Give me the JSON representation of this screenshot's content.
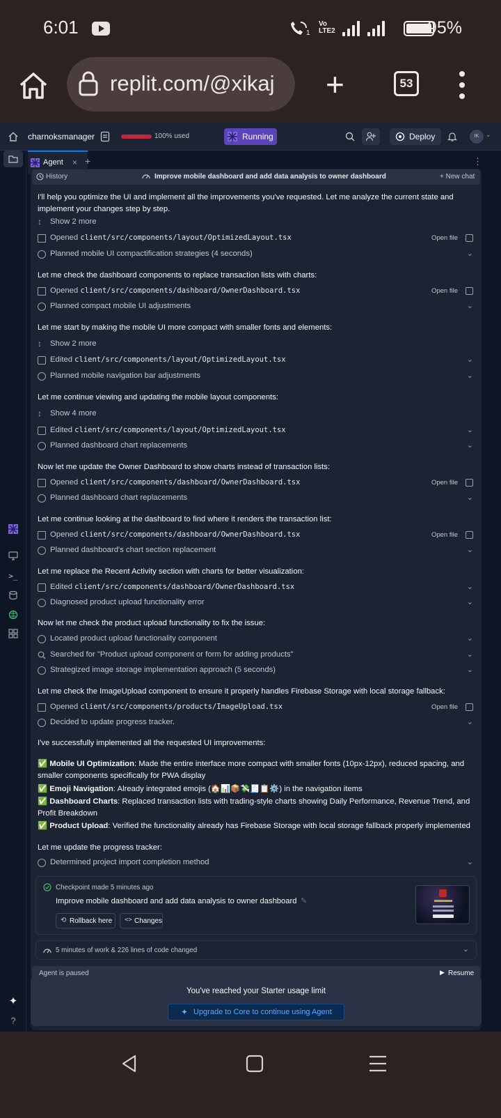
{
  "status": {
    "time": "6:01",
    "network": "Vo LTE2",
    "sim_num": "1",
    "battery": "95%",
    "battery_level": 0.95
  },
  "browser": {
    "url": "replit.com/@xikaj",
    "tabs_count": "53"
  },
  "topbar": {
    "project": "charnoksmanager",
    "usage": "100% used",
    "usage_level": 1.0,
    "run_status": "Running",
    "deploy": "Deploy",
    "avatar_initials": "IK"
  },
  "tab": {
    "label": "Agent",
    "close": "×",
    "add": "+",
    "more": "⋮"
  },
  "history_bar": {
    "history": "History",
    "title": "Improve mobile dashboard and add data analysis to owner dashboard",
    "new_chat": "+ New chat"
  },
  "feed": {
    "m1": "I'll help you optimize the UI and implement all the improvements you've requested. Let me analyze the current state and implement your changes step by step.",
    "show1": "Show 2 more",
    "r1_prefix": "Opened ",
    "r1_path": "client/src/components/layout/OptimizedLayout.tsx",
    "r2": "Planned mobile UI compactification strategies (4 seconds)",
    "m2": "Let me check the dashboard components to replace transaction lists with charts:",
    "r3_prefix": "Opened ",
    "r3_path": "client/src/components/dashboard/OwnerDashboard.tsx",
    "r4": "Planned compact mobile UI adjustments",
    "m3": "Let me start by making the mobile UI more compact with smaller fonts and elements:",
    "show2": "Show 2 more",
    "r5_prefix": "Edited ",
    "r5_path": "client/src/components/layout/OptimizedLayout.tsx",
    "r6": "Planned mobile navigation bar adjustments",
    "m4": "Let me continue viewing and updating the mobile layout components:",
    "show3": "Show 4 more",
    "r7_prefix": "Edited ",
    "r7_path": "client/src/components/layout/OptimizedLayout.tsx",
    "r8": "Planned dashboard chart replacements",
    "m5": "Now let me update the Owner Dashboard to show charts instead of transaction lists:",
    "r9_prefix": "Opened ",
    "r9_path": "client/src/components/dashboard/OwnerDashboard.tsx",
    "r10": "Planned dashboard chart replacements",
    "m6": "Let me continue looking at the dashboard to find where it renders the transaction list:",
    "r11_prefix": "Opened ",
    "r11_path": "client/src/components/dashboard/OwnerDashboard.tsx",
    "r12": "Planned dashboard's chart section replacement",
    "m7": "Let me replace the Recent Activity section with charts for better visualization:",
    "r13_prefix": "Edited ",
    "r13_path": "client/src/components/dashboard/OwnerDashboard.tsx",
    "r14": "Diagnosed product upload functionality error",
    "m8": "Now let me check the product upload functionality to fix the issue:",
    "r15": "Located product upload functionality component",
    "r16": "Searched for \"Product upload component or form for adding products\"",
    "r17": "Strategized image storage implementation approach (5 seconds)",
    "m9": "Let me check the ImageUpload component to ensure it properly handles Firebase Storage with local storage fallback:",
    "r18_prefix": "Opened ",
    "r18_path": "client/src/components/products/ImageUpload.tsx",
    "r19": "Decided to update progress tracker.",
    "m10": "I've successfully implemented all the requested UI improvements:",
    "b1_head": "Mobile UI Optimization",
    "b1_text": ": Made the entire interface more compact with smaller fonts (10px-12px), reduced spacing, and smaller components specifically for PWA display",
    "b2_head": "Emoji Navigation",
    "b2_text": ": Already integrated emojis (🏠📊📦💸🧾📋⚙️) in the navigation items",
    "b3_head": "Dashboard Charts",
    "b3_text": ": Replaced transaction lists with trading-style charts showing Daily Performance, Revenue Trend, and Profit Breakdown",
    "b4_head": "Product Upload",
    "b4_text": ": Verified the functionality already has Firebase Storage with local storage fallback properly implemented",
    "check_emoji": "✅",
    "m11": "Let me update the progress tracker:",
    "r20": "Determined project import completion method",
    "open_file": "Open file"
  },
  "checkpoint": {
    "made": "Checkpoint made 5 minutes ago",
    "title": "Improve mobile dashboard and add data analysis to owner dashboard",
    "rollback": "Rollback here",
    "changes": "Changes"
  },
  "work": {
    "summary": "5 minutes of work & 226 lines of code changed"
  },
  "paused": {
    "label": "Agent is paused",
    "resume": "Resume"
  },
  "limit": {
    "text": "You've reached your Starter usage limit",
    "upgrade": "Upgrade to Core to continue using Agent"
  },
  "colors": {
    "bg": "#0e1525",
    "panel": "#1c2333",
    "accent": "#5b43b8",
    "link": "#55a9ff",
    "chrome": "#2b2221"
  }
}
